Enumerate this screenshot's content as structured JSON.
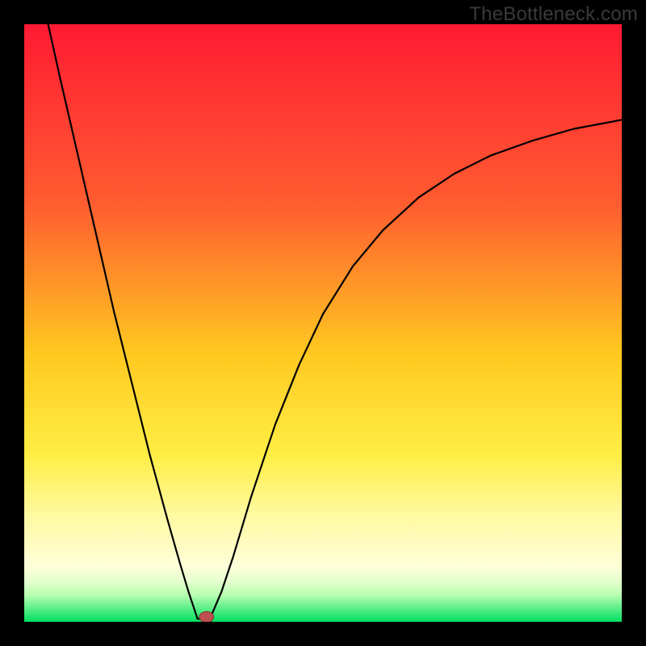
{
  "watermark": "TheBottleneck.com",
  "chart_data": {
    "type": "line",
    "title": "",
    "xlabel": "",
    "ylabel": "",
    "xlim": [
      0,
      100
    ],
    "ylim": [
      0,
      100
    ],
    "grid": false,
    "legend": false,
    "background_gradient": {
      "direction": "vertical",
      "stops": [
        {
          "pos": 0.0,
          "color": "#ff1a33"
        },
        {
          "pos": 0.3,
          "color": "#ff5c30"
        },
        {
          "pos": 0.55,
          "color": "#ffc820"
        },
        {
          "pos": 0.72,
          "color": "#ffee44"
        },
        {
          "pos": 0.82,
          "color": "#fff9a0"
        },
        {
          "pos": 0.905,
          "color": "#ffffd8"
        },
        {
          "pos": 0.93,
          "color": "#e8ffd0"
        },
        {
          "pos": 0.955,
          "color": "#b8ffb0"
        },
        {
          "pos": 0.975,
          "color": "#66f08c"
        },
        {
          "pos": 1.0,
          "color": "#00e060"
        }
      ]
    },
    "series": [
      {
        "name": "bottleneck-curve",
        "color": "#000000",
        "width": 2.2,
        "points": [
          {
            "x": 4.0,
            "y": 100.0
          },
          {
            "x": 6.0,
            "y": 91.0
          },
          {
            "x": 9.0,
            "y": 78.0
          },
          {
            "x": 12.0,
            "y": 65.0
          },
          {
            "x": 15.0,
            "y": 52.0
          },
          {
            "x": 18.0,
            "y": 40.0
          },
          {
            "x": 21.0,
            "y": 28.0
          },
          {
            "x": 24.0,
            "y": 17.0
          },
          {
            "x": 26.0,
            "y": 10.0
          },
          {
            "x": 27.5,
            "y": 5.0
          },
          {
            "x": 28.5,
            "y": 2.0
          },
          {
            "x": 29.0,
            "y": 0.5
          },
          {
            "x": 30.5,
            "y": 0.5
          },
          {
            "x": 31.5,
            "y": 1.5
          },
          {
            "x": 33.0,
            "y": 5.0
          },
          {
            "x": 35.0,
            "y": 11.0
          },
          {
            "x": 38.0,
            "y": 21.0
          },
          {
            "x": 42.0,
            "y": 33.0
          },
          {
            "x": 46.0,
            "y": 43.0
          },
          {
            "x": 50.0,
            "y": 51.5
          },
          {
            "x": 55.0,
            "y": 59.5
          },
          {
            "x": 60.0,
            "y": 65.5
          },
          {
            "x": 66.0,
            "y": 71.0
          },
          {
            "x": 72.0,
            "y": 75.0
          },
          {
            "x": 78.0,
            "y": 78.0
          },
          {
            "x": 85.0,
            "y": 80.5
          },
          {
            "x": 92.0,
            "y": 82.5
          },
          {
            "x": 100.0,
            "y": 84.0
          }
        ]
      }
    ],
    "marker": {
      "name": "optimal-point",
      "x": 30.5,
      "y": 0.8,
      "rx": 1.2,
      "ry": 0.9,
      "fill": "#c05050",
      "stroke": "#803030"
    }
  }
}
